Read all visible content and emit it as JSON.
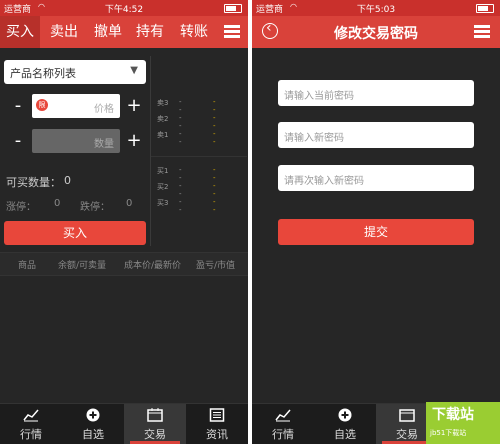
{
  "left": {
    "status": {
      "carrier": "运营商",
      "time": "下午4:52"
    },
    "tabs": [
      "买入",
      "卖出",
      "撤单",
      "持有",
      "转账"
    ],
    "dropdown": "产品名称列表",
    "price_ph": "价格",
    "qty_ph": "数量",
    "buyable_label": "可买数量：",
    "buyable_value": "0",
    "limit_up_label": "涨停：",
    "limit_up_value": "0",
    "limit_down_label": "跌停：",
    "limit_down_value": "0",
    "buy_button": "买入",
    "orderbook": {
      "sell": [
        "卖3",
        "卖2",
        "卖1"
      ],
      "buy": [
        "买1",
        "买2",
        "买3"
      ],
      "dash": "--"
    },
    "columns": [
      "商品",
      "余额/可卖量",
      "成本价/最新价",
      "盈亏/市值"
    ]
  },
  "right": {
    "status": {
      "carrier": "运营商",
      "time": "下午5:03"
    },
    "title": "修改交易密码",
    "fields": [
      "请输入当前密码",
      "请输入新密码",
      "请再次输入新密码"
    ],
    "submit": "提交"
  },
  "nav": [
    "行情",
    "自选",
    "交易",
    "资讯"
  ],
  "watermark": {
    "title": "下载站",
    "sub": "jb51下载站"
  },
  "colors": {
    "red": "#d9423a",
    "dark": "#262626"
  }
}
